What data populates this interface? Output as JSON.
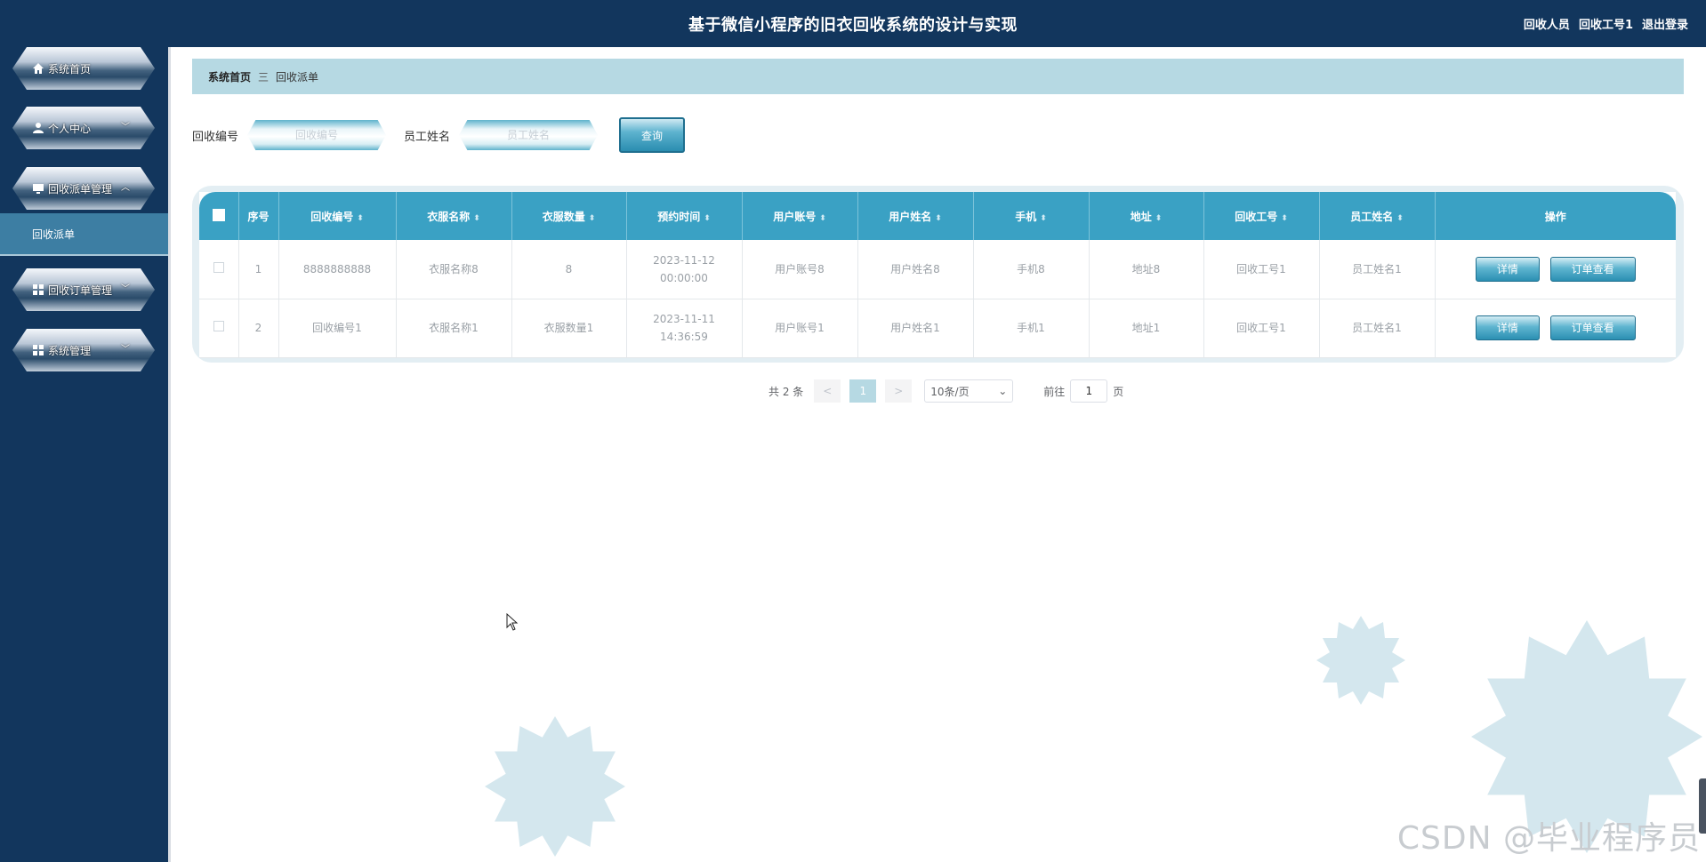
{
  "header": {
    "title": "基于微信小程序的旧衣回收系统的设计与实现",
    "role": "回收人员",
    "user": "回收工号1",
    "logout": "退出登录"
  },
  "sidebar": {
    "items": [
      {
        "label": "系统首页",
        "icon": "home-icon"
      },
      {
        "label": "个人中心",
        "icon": "user-icon",
        "chevron": "﹀"
      },
      {
        "label": "回收派单管理",
        "icon": "monitor-icon",
        "chevron": "︿"
      },
      {
        "label": "回收订单管理",
        "icon": "grid-icon",
        "chevron": "﹀"
      },
      {
        "label": "系统管理",
        "icon": "grid-icon",
        "chevron": "﹀"
      }
    ],
    "submenu_active": "回收派单"
  },
  "breadcrumb": {
    "home": "系统首页",
    "sep": "三",
    "current": "回收派单"
  },
  "search": {
    "field1_label": "回收编号",
    "field1_placeholder": "回收编号",
    "field2_label": "员工姓名",
    "field2_placeholder": "员工姓名",
    "query_button": "查询"
  },
  "table": {
    "columns": [
      "序号",
      "回收编号",
      "衣服名称",
      "衣服数量",
      "预约时间",
      "用户账号",
      "用户姓名",
      "手机",
      "地址",
      "回收工号",
      "员工姓名",
      "操作"
    ],
    "rows": [
      [
        "1",
        "8888888888",
        "衣服名称8",
        "8",
        "2023-11-12 00:00:00",
        "用户账号8",
        "用户姓名8",
        "手机8",
        "地址8",
        "回收工号1",
        "员工姓名1"
      ],
      [
        "2",
        "回收编号1",
        "衣服名称1",
        "衣服数量1",
        "2023-11-11 14:36:59",
        "用户账号1",
        "用户姓名1",
        "手机1",
        "地址1",
        "回收工号1",
        "员工姓名1"
      ]
    ],
    "detail_button": "详情",
    "order_button": "订单查看"
  },
  "pagination": {
    "total": "共 2 条",
    "prev": "<",
    "page": "1",
    "next": ">",
    "page_size": "10条/页",
    "goto_label": "前往",
    "goto_value": "1",
    "page_unit": "页"
  },
  "watermark": "CSDN @毕业程序员"
}
